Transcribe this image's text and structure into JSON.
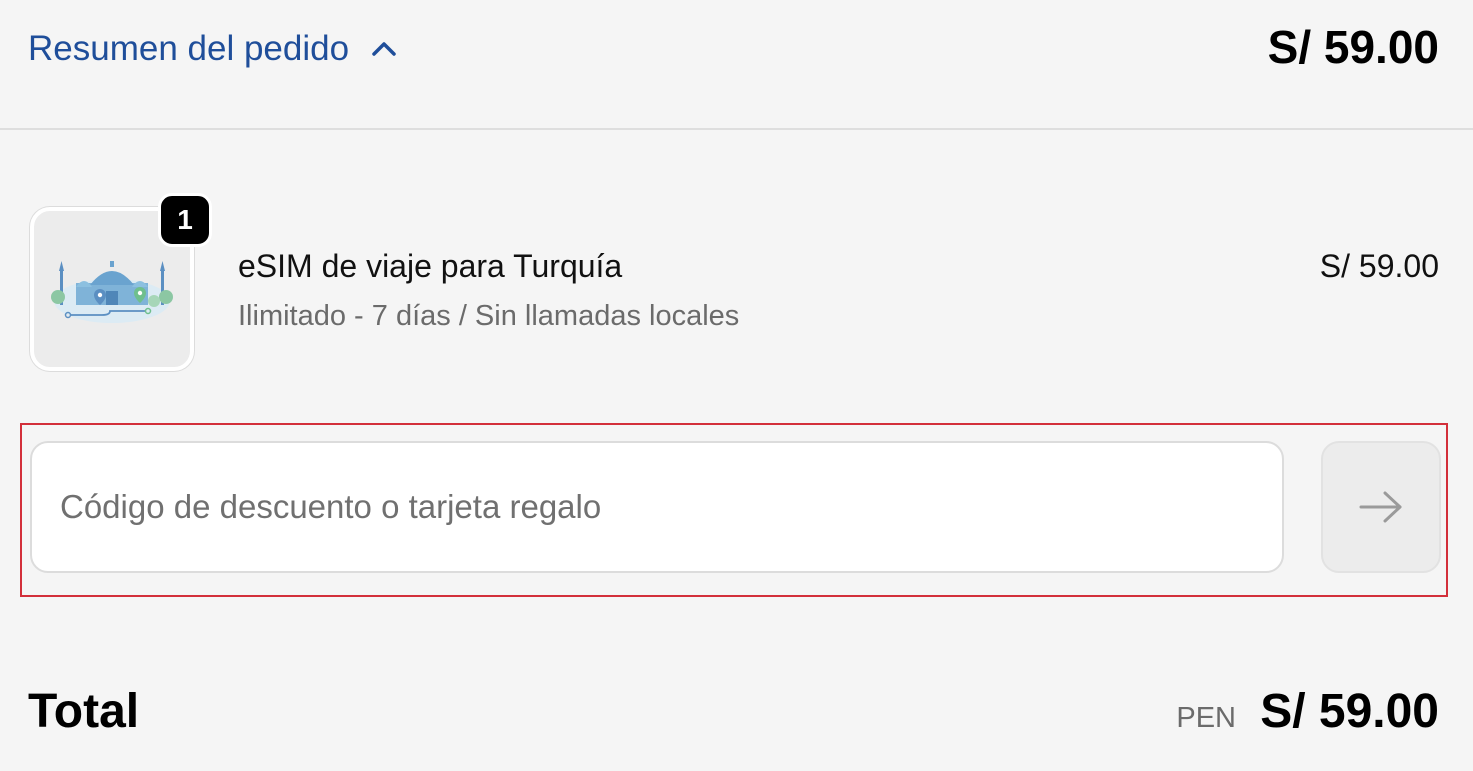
{
  "summary": {
    "toggle_label": "Resumen del pedido",
    "toggle_icon": "chevron-up-icon",
    "header_total": "S/ 59.00"
  },
  "product": {
    "quantity": "1",
    "name": "eSIM de viaje para Turquía",
    "variant": "Ilimitado - 7 días / Sin llamadas locales",
    "price": "S/ 59.00",
    "image": "istanbul-mosque-illustration"
  },
  "discount": {
    "placeholder": "Código de descuento o tarjeta regalo",
    "value": "",
    "apply_icon": "arrow-right-icon"
  },
  "total": {
    "label": "Total",
    "currency": "PEN",
    "amount": "S/ 59.00"
  },
  "colors": {
    "link_blue": "#1f4e9a",
    "background": "#f5f5f5",
    "highlight_red": "#d32f3a"
  }
}
